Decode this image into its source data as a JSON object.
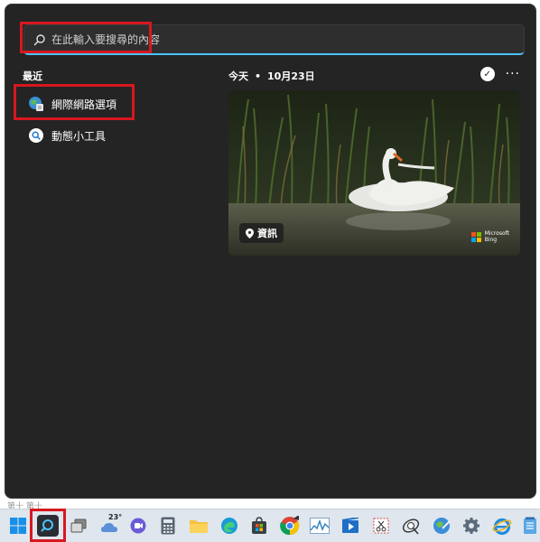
{
  "search": {
    "placeholder": "在此輸入要搜尋的內容"
  },
  "recent": {
    "title": "最近",
    "items": [
      {
        "label": "網際網路選項",
        "icon": "internet-options-icon"
      },
      {
        "label": "動態小工具",
        "icon": "search-icon"
      }
    ]
  },
  "today": {
    "label": "今天",
    "date": "10月23日",
    "news_label": "資訊",
    "bing_brand_line1": "Microsoft",
    "bing_brand_line2": "Bing"
  },
  "background": {
    "text": "第十 第十"
  },
  "taskbar": {
    "weather_temp": "23°",
    "icons": [
      "start-icon",
      "search-icon",
      "task-view-icon",
      "weather-icon",
      "chat-icon",
      "calculator-icon",
      "file-explorer-icon",
      "edge-icon",
      "store-icon",
      "chrome-icon",
      "performance-icon",
      "movies-icon",
      "snipping-icon",
      "satellite-icon",
      "network-icon",
      "settings-icon",
      "internet-explorer-icon",
      "notepad-icon"
    ]
  },
  "colors": {
    "flyout_bg": "#242424",
    "accent": "#4cc2ff",
    "highlight_red": "#d8171f"
  }
}
